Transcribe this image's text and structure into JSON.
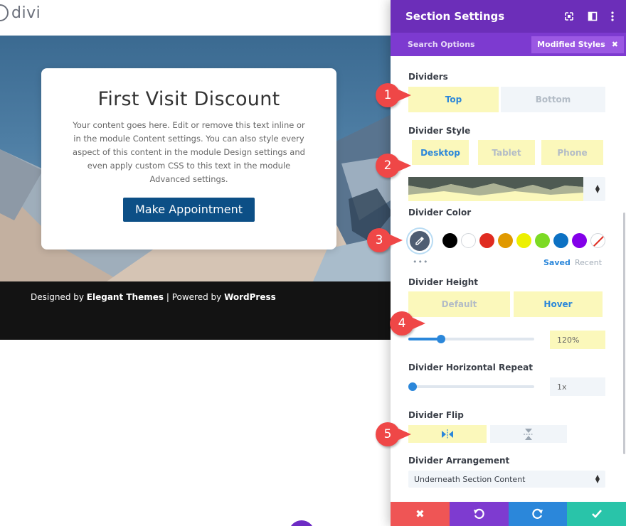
{
  "site": {
    "logo_text": "divi",
    "card": {
      "title": "First Visit Discount",
      "body": "Your content goes here. Edit or remove this text inline or in the module Content settings. You can also style every aspect of this content in the module Design settings and even apply custom CSS to this text in the module Advanced settings.",
      "button": "Make Appointment"
    },
    "footer": {
      "prefix": "Designed by ",
      "brand": "Elegant Themes",
      "middle": " | Powered by ",
      "platform": "WordPress"
    }
  },
  "modal": {
    "title": "Section Settings",
    "search_placeholder": "Search Options",
    "modified_styles": "Modified Styles",
    "dividers": {
      "label": "Dividers",
      "tabs": [
        "Top",
        "Bottom"
      ],
      "active": "Top"
    },
    "divider_style": {
      "label": "Divider Style",
      "devices": [
        "Desktop",
        "Tablet",
        "Phone"
      ],
      "active": "Desktop"
    },
    "divider_color": {
      "label": "Divider Color",
      "swatches": [
        "#000000",
        "#ffffff",
        "#e02b20",
        "#e09900",
        "#edf000",
        "#7cda24",
        "#0c71c3",
        "#8300e9"
      ],
      "saved": "Saved",
      "recent": "Recent",
      "more": "•••"
    },
    "divider_height": {
      "label": "Divider Height",
      "states": [
        "Default",
        "Hover"
      ],
      "active": "Hover",
      "value": "120%",
      "slider_fraction": 0.26
    },
    "divider_repeat": {
      "label": "Divider Horizontal Repeat",
      "value": "1x",
      "slider_fraction": 0.0
    },
    "divider_flip": {
      "label": "Divider Flip"
    },
    "divider_arrangement": {
      "label": "Divider Arrangement",
      "value": "Underneath Section Content"
    },
    "colors": {
      "header": "#6c2eb9",
      "subheader": "#7d3ad0",
      "accent": "#2b87da",
      "highlight": "#fbf8bb"
    }
  },
  "actions": [
    {
      "name": "cancel",
      "icon": "close-icon",
      "color": "#ef5555"
    },
    {
      "name": "undo",
      "icon": "undo-icon",
      "color": "#7e3bd0"
    },
    {
      "name": "redo",
      "icon": "redo-icon",
      "color": "#2b87da"
    },
    {
      "name": "save",
      "icon": "check-icon",
      "color": "#29c4a9"
    }
  ],
  "callouts": [
    "1",
    "2",
    "3",
    "4",
    "5"
  ]
}
